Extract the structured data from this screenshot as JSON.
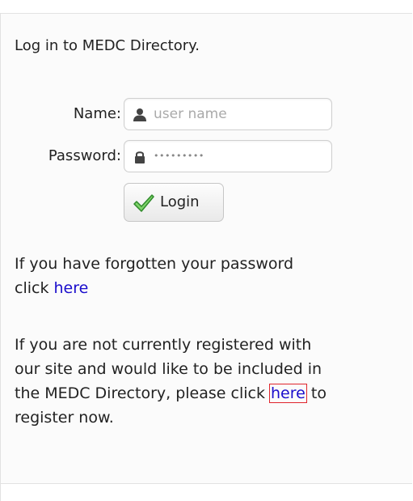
{
  "intro": "Log in to MEDC Directory.",
  "form": {
    "name_label": "Name:",
    "name_placeholder": "user name",
    "password_label": "Password:",
    "password_value": "•••••••••",
    "login_label": "Login",
    "icons": [
      "user-icon",
      "lock-icon",
      "checkmark-icon"
    ]
  },
  "forgot": {
    "line1": "If you have forgotten your password",
    "line2_prefix": "click ",
    "link": "here"
  },
  "register": {
    "line1": "If you are not currently registered with",
    "line2": "our site and would like to be included in",
    "line3_prefix": "the MEDC Directory, please click ",
    "link": "here",
    "line3_suffix": " to",
    "line4": "register now."
  },
  "colors": {
    "link": "#1a0dcc",
    "highlight_border": "#e0242c",
    "checkmark": "#3aa035"
  }
}
